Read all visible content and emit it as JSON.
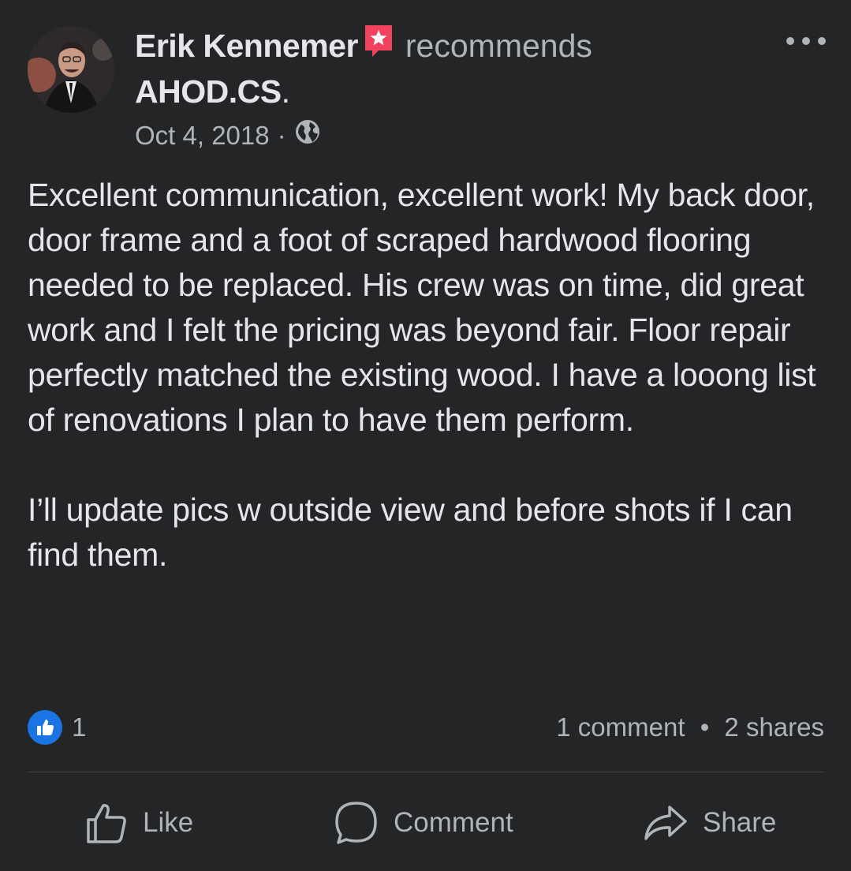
{
  "post": {
    "author": "Erik Kennemer",
    "verb": "recommends",
    "page": "AHOD.CS",
    "period": ".",
    "date": "Oct 4, 2018",
    "separator": "·",
    "paragraphs": [
      "Excellent communication, excellent work! My back door, door frame and a foot of scraped hardwood flooring needed to be replaced. His crew was on time, did great work and I felt the pricing was beyond fair. Floor repair perfectly matched the existing wood. I have a looong list of renovations I plan to have them perform.",
      "I’ll update pics w outside view and before shots if I can find them."
    ]
  },
  "engagement": {
    "like_count": "1",
    "comments": "1 comment",
    "dot": "•",
    "shares": "2 shares"
  },
  "actions": {
    "like": "Like",
    "comment": "Comment",
    "share": "Share"
  },
  "colors": {
    "background": "#242526",
    "text_primary": "#e4e6eb",
    "text_secondary": "#b0b3b8",
    "like_blue": "#1b74e4",
    "recommend_red": "#f3425f"
  },
  "icons": {
    "recommend": "recommend-star-icon",
    "audience": "globe-icon",
    "more": "more-options-icon",
    "reaction": "like-reaction-icon",
    "like": "thumbs-up-icon",
    "comment": "comment-bubble-icon",
    "share": "share-arrow-icon"
  }
}
